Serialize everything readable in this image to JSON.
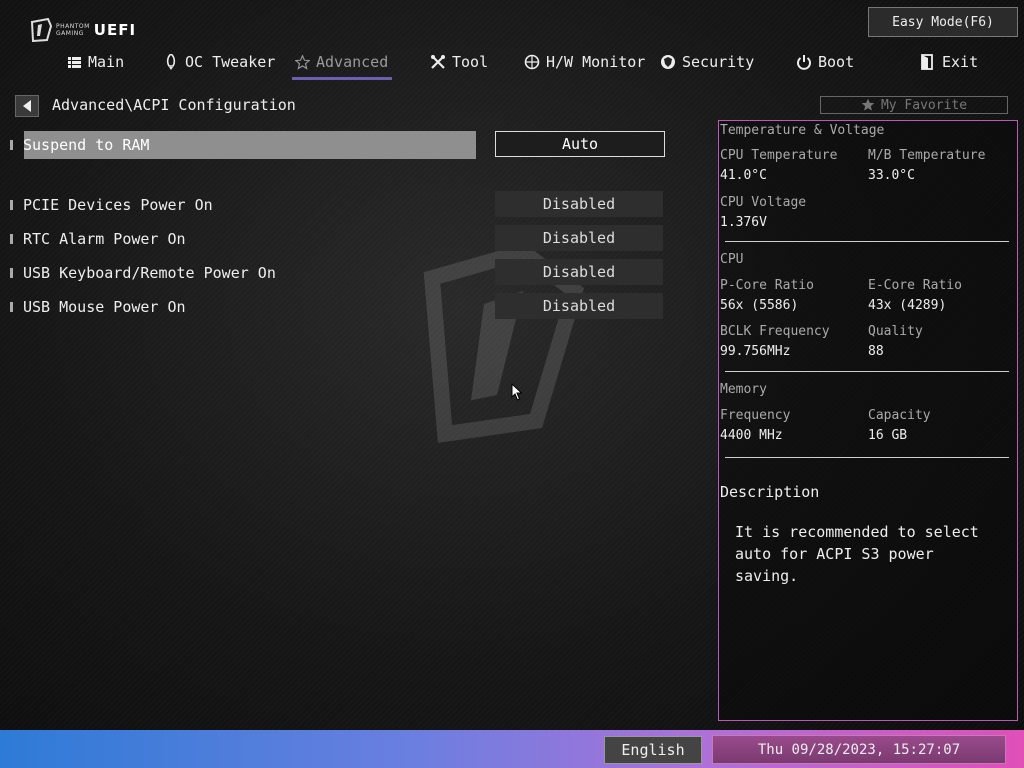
{
  "brand": {
    "line1": "PHANTOM",
    "line2": "GAMING",
    "product": "UEFI"
  },
  "easy_mode_label": "Easy Mode(F6)",
  "tabs": [
    {
      "label": "Main",
      "icon": "list-icon"
    },
    {
      "label": "OC Tweaker",
      "icon": "rocket-icon"
    },
    {
      "label": "Advanced",
      "icon": "star-icon"
    },
    {
      "label": "Tool",
      "icon": "tools-icon"
    },
    {
      "label": "H/W Monitor",
      "icon": "monitor-icon"
    },
    {
      "label": "Security",
      "icon": "shield-icon"
    },
    {
      "label": "Boot",
      "icon": "power-icon"
    },
    {
      "label": "Exit",
      "icon": "exit-icon"
    }
  ],
  "active_tab": "Advanced",
  "breadcrumb": "Advanced\\ACPI Configuration",
  "favorite_label": "My Favorite",
  "settings": [
    {
      "label": "Suspend to RAM",
      "value": "Auto"
    },
    {
      "label": "PCIE Devices Power On",
      "value": "Disabled"
    },
    {
      "label": "RTC Alarm Power On",
      "value": "Disabled"
    },
    {
      "label": "USB Keyboard/Remote Power On",
      "value": "Disabled"
    },
    {
      "label": "USB Mouse Power On",
      "value": "Disabled"
    }
  ],
  "monitor": {
    "title": "Temperature & Voltage",
    "cpu_temp_label": "CPU Temperature",
    "cpu_temp": "41.0°C",
    "mb_temp_label": "M/B Temperature",
    "mb_temp": "33.0°C",
    "cpu_voltage_label": "CPU Voltage",
    "cpu_voltage": "1.376V",
    "cpu_title": "CPU",
    "pcore_label": "P-Core Ratio",
    "pcore": "56x (5586)",
    "ecore_label": "E-Core Ratio",
    "ecore": "43x (4289)",
    "bclk_label": "BCLK Frequency",
    "bclk": "99.756MHz",
    "quality_label": "Quality",
    "quality": "88",
    "memory_title": "Memory",
    "freq_label": "Frequency",
    "freq": "4400 MHz",
    "capacity_label": "Capacity",
    "capacity": "16 GB"
  },
  "description": {
    "title": "Description",
    "text": "It is recommended to select auto for ACPI S3 power saving."
  },
  "footer": {
    "language": "English",
    "datetime": "Thu 09/28/2023, 15:27:07"
  },
  "colors": {
    "accent": "#6d5fb0",
    "panel_border": "#b85ab8"
  }
}
